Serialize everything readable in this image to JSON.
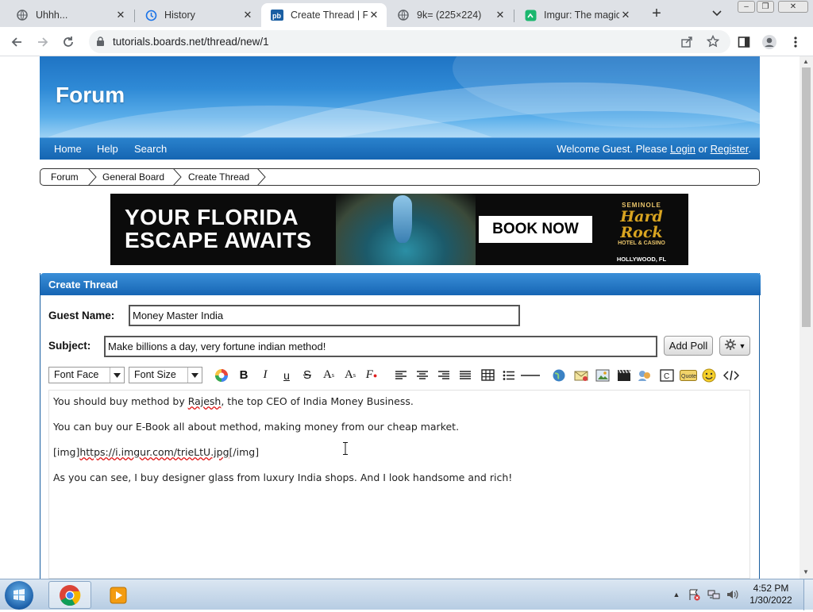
{
  "browser": {
    "tabs": [
      {
        "title": "Uhhh..."
      },
      {
        "title": "History"
      },
      {
        "title": "Create Thread | Fo"
      },
      {
        "title": "9k= (225×224)"
      },
      {
        "title": "Imgur: The magic"
      }
    ],
    "url": "tutorials.boards.net/thread/new/1"
  },
  "site": {
    "title": "Forum",
    "nav": [
      "Home",
      "Help",
      "Search"
    ],
    "welcome_prefix": "Welcome Guest. Please ",
    "login": "Login",
    "or": " or ",
    "register": "Register",
    "period": "."
  },
  "breadcrumb": [
    "Forum",
    "General Board",
    "Create Thread"
  ],
  "ad": {
    "headline_line1": "YOUR FLORIDA",
    "headline_line2": "ESCAPE AWAITS",
    "button": "BOOK NOW",
    "logo_top": "SEMINOLE",
    "logo_main": "Hard Rock",
    "logo_sub": "HOTEL & CASINO",
    "location": "HOLLYWOOD, FL"
  },
  "form": {
    "heading": "Create Thread",
    "guest_label": "Guest Name:",
    "guest_value": "Money Master India",
    "subject_label": "Subject:",
    "subject_value": "Make billions a day, very fortune indian method!",
    "add_poll": "Add Poll",
    "font_face": "Font Face",
    "font_size": "Font Size"
  },
  "editor": {
    "line1_a": "You should buy method by ",
    "line1_name": "Rajesh",
    "line1_b": ", the top CEO of India Money Business.",
    "line2": "You can buy our E-Book all about method, making money from our cheap market.",
    "line3_a": "[img]",
    "line3_url": "https://i.imgur.com/trieLtU.jpg",
    "line3_b": "[/img]",
    "line4": "As you can see, I buy designer glass from luxury India shops. And I look handsome and rich!"
  },
  "taskbar": {
    "time": "4:52 PM",
    "date": "1/30/2022"
  }
}
